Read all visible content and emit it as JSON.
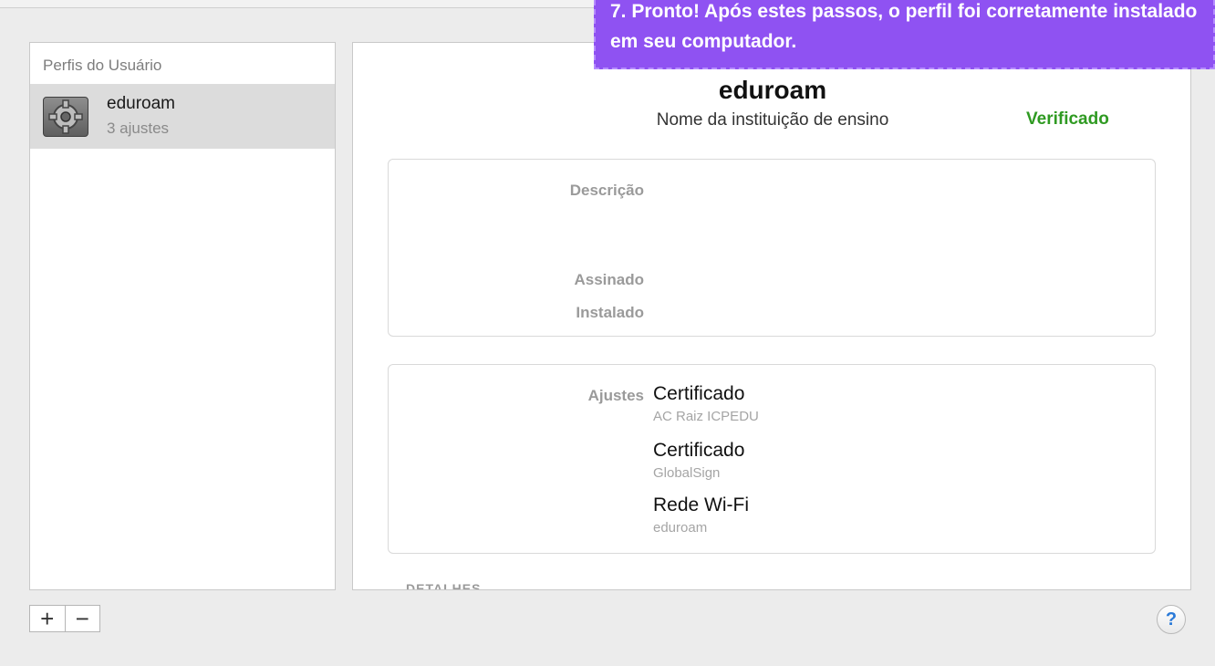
{
  "sidebar": {
    "header": "Perfis do Usuário",
    "profile": {
      "name": "eduroam",
      "count": "3 ajustes",
      "icon": "gear-icon"
    }
  },
  "controls": {
    "add": "+",
    "remove": "−",
    "help": "?"
  },
  "profile": {
    "title": "eduroam",
    "organization": "Nome da instituição de ensino",
    "status": "Verificado",
    "status_color": "#2f9a22"
  },
  "info": {
    "description_label": "Descrição",
    "signed_label": "Assinado",
    "installed_label": "Instalado"
  },
  "settings": {
    "label": "Ajustes",
    "items": [
      {
        "title": "Certificado",
        "subtitle": "AC Raiz ICPEDU"
      },
      {
        "title": "Certificado",
        "subtitle": "GlobalSign"
      },
      {
        "title": "Rede Wi-Fi",
        "subtitle": "eduroam"
      }
    ]
  },
  "details_label": "DETALHES",
  "banner": {
    "text": "7. Pronto! Após estes passos, o perfil foi corretamente instalado em seu computador.",
    "color": "#8f52f2"
  }
}
